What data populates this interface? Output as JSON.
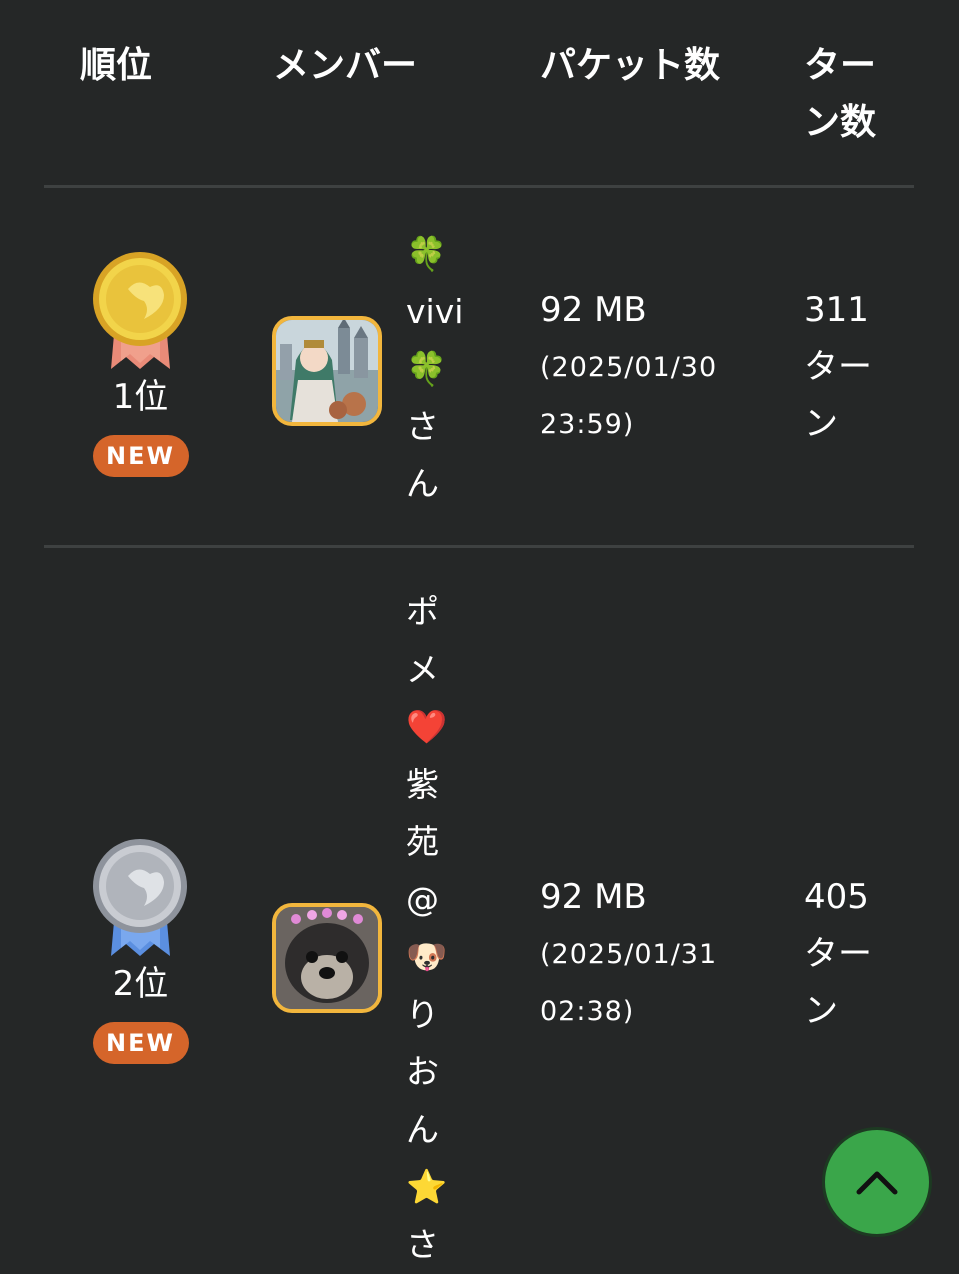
{
  "table": {
    "headers": {
      "rank": "順位",
      "member": "メンバー",
      "packets": "パケット数",
      "turns": "ターン数"
    },
    "rows": [
      {
        "rank_label": "1位",
        "badge": "NEW",
        "medal": "gold",
        "avatar_icon": "anime-character-castle-avatar",
        "name": "🍀vivi🍀さん",
        "packet_size": "92 MB",
        "packet_date": "(2025/01/30 23:59)",
        "turns": "311ターン"
      },
      {
        "rank_label": "2位",
        "badge": "NEW",
        "medal": "silver",
        "avatar_icon": "puppy-avatar",
        "name": "ポメ❤️紫苑@🐶りおん⭐️さ",
        "packet_size": "92 MB",
        "packet_date": "(2025/01/31 02:38)",
        "turns": "405ターン"
      }
    ]
  },
  "colors": {
    "background": "#252727",
    "divider": "#3e4141",
    "new_badge": "#d5652a",
    "avatar_border": "#f2b63d",
    "scroll_button": "#3aa64a",
    "gold": "#e8c53a",
    "silver": "#b9bcc4"
  },
  "scroll_top": {
    "icon": "chevron-up-icon"
  }
}
